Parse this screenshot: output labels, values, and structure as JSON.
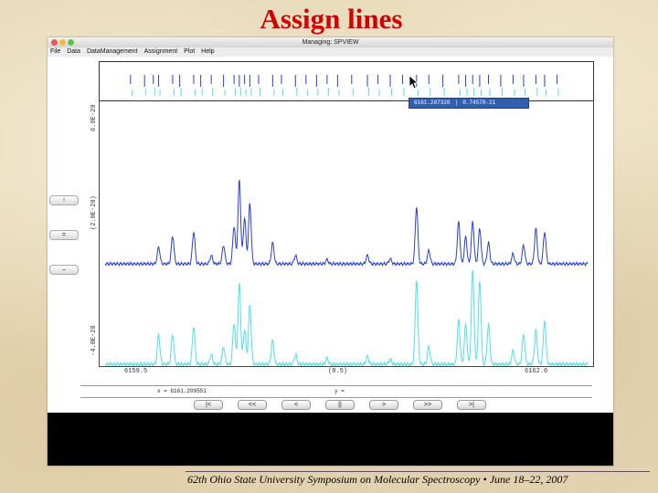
{
  "slide": {
    "title": "Assign lines",
    "footer": "62th Ohio State University Symposium on Molecular Spectroscopy • June 18–22, 2007"
  },
  "window": {
    "title": "Managing: SPVIEW",
    "menu": [
      "File",
      "Data",
      "DataManagement",
      "Assignment",
      "Plot",
      "Help"
    ]
  },
  "sidebar": {
    "buttons": [
      "↑",
      "=",
      "–"
    ]
  },
  "tooltip": {
    "x_value": "6161.207320",
    "y_value": "0.74578-21"
  },
  "plot": {
    "y_axis_ticks": [
      "6.0E-20",
      "(2.0E-20)",
      "-4.0E-20"
    ],
    "x_axis_ticks": [
      "6159.5",
      "(0.5)",
      "6162.0"
    ]
  },
  "status": {
    "x_readout": "x = 6161.209551",
    "y_readout": "y ="
  },
  "navigation": {
    "buttons": [
      "|<",
      "<<",
      "<",
      "||",
      ">",
      ">>",
      ">|"
    ]
  },
  "colors": {
    "title_red": "#d20000",
    "observed_spectrum": "#2a3fd0",
    "calculated_spectrum": "#4fe0e8",
    "tooltip_bg": "#2f5fae"
  },
  "chart_data": {
    "type": "line",
    "x_range": [
      6159.5,
      6162.0
    ],
    "series": [
      {
        "color": "#2a3fd0",
        "peaks": [
          [
            6159.68,
            0.2
          ],
          [
            6159.76,
            0.33
          ],
          [
            6159.88,
            0.38
          ],
          [
            6159.98,
            0.1
          ],
          [
            6160.05,
            0.22
          ],
          [
            6160.11,
            0.45
          ],
          [
            6160.14,
            1.0
          ],
          [
            6160.17,
            0.55
          ],
          [
            6160.2,
            0.72
          ],
          [
            6160.33,
            0.25
          ],
          [
            6160.46,
            0.1
          ],
          [
            6160.64,
            0.05
          ],
          [
            6160.87,
            0.1
          ],
          [
            6161.0,
            0.06
          ],
          [
            6161.15,
            0.68
          ],
          [
            6161.22,
            0.16
          ],
          [
            6161.39,
            0.5
          ],
          [
            6161.43,
            0.32
          ],
          [
            6161.47,
            0.5
          ],
          [
            6161.51,
            0.42
          ],
          [
            6161.56,
            0.25
          ],
          [
            6161.7,
            0.12
          ],
          [
            6161.76,
            0.22
          ],
          [
            6161.83,
            0.42
          ],
          [
            6161.88,
            0.38
          ]
        ]
      },
      {
        "color": "#4fe0e8",
        "peaks": [
          [
            6159.68,
            0.3
          ],
          [
            6159.76,
            0.3
          ],
          [
            6159.88,
            0.38
          ],
          [
            6159.98,
            0.1
          ],
          [
            6160.05,
            0.18
          ],
          [
            6160.11,
            0.42
          ],
          [
            6160.14,
            0.82
          ],
          [
            6160.17,
            0.35
          ],
          [
            6160.2,
            0.6
          ],
          [
            6160.33,
            0.24
          ],
          [
            6160.46,
            0.1
          ],
          [
            6160.64,
            0.06
          ],
          [
            6160.87,
            0.08
          ],
          [
            6161.0,
            0.05
          ],
          [
            6161.15,
            0.86
          ],
          [
            6161.22,
            0.18
          ],
          [
            6161.39,
            0.45
          ],
          [
            6161.43,
            0.4
          ],
          [
            6161.47,
            0.95
          ],
          [
            6161.51,
            0.85
          ],
          [
            6161.56,
            0.4
          ],
          [
            6161.7,
            0.14
          ],
          [
            6161.76,
            0.3
          ],
          [
            6161.83,
            0.35
          ],
          [
            6161.88,
            0.45
          ]
        ]
      }
    ],
    "line_positions": [
      6159.52,
      6159.6,
      6159.65,
      6159.68,
      6159.76,
      6159.8,
      6159.88,
      6159.92,
      6159.98,
      6160.05,
      6160.11,
      6160.14,
      6160.17,
      6160.2,
      6160.25,
      6160.33,
      6160.38,
      6160.46,
      6160.52,
      6160.58,
      6160.64,
      6160.7,
      6160.78,
      6160.87,
      6160.93,
      6161.0,
      6161.07,
      6161.15,
      6161.22,
      6161.3,
      6161.39,
      6161.43,
      6161.47,
      6161.51,
      6161.56,
      6161.63,
      6161.7,
      6161.76,
      6161.83,
      6161.88,
      6161.95
    ]
  }
}
